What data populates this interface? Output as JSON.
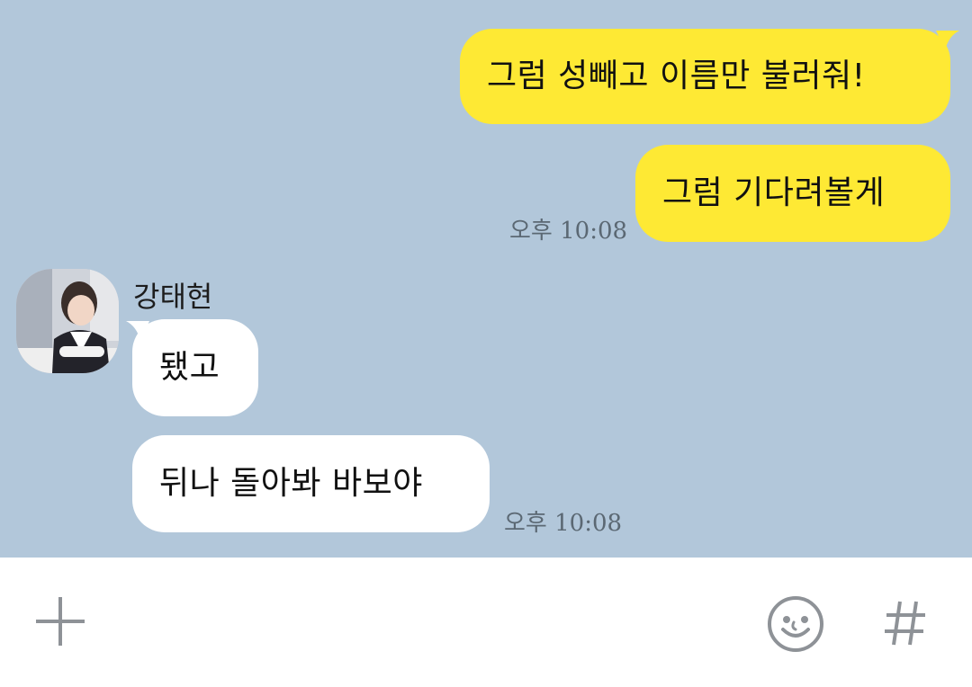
{
  "messages": {
    "out1": "그럼 성빼고 이름만 불러줘!",
    "out2": "그럼 기다려볼게",
    "out_time": "오후 10:08",
    "sender_name": "강태현",
    "in1": "됐고",
    "in2": "뒤나 돌아봐 바보야",
    "in_time": "오후 10:08"
  },
  "input_bar": {
    "add_icon": "plus-icon",
    "emoji_icon": "smiley-icon",
    "hash_icon": "hash-icon"
  },
  "colors": {
    "chat_background": "#b2c7da",
    "outgoing_bubble": "#fee934",
    "incoming_bubble": "#ffffff",
    "icon_gray": "#8e9297"
  }
}
